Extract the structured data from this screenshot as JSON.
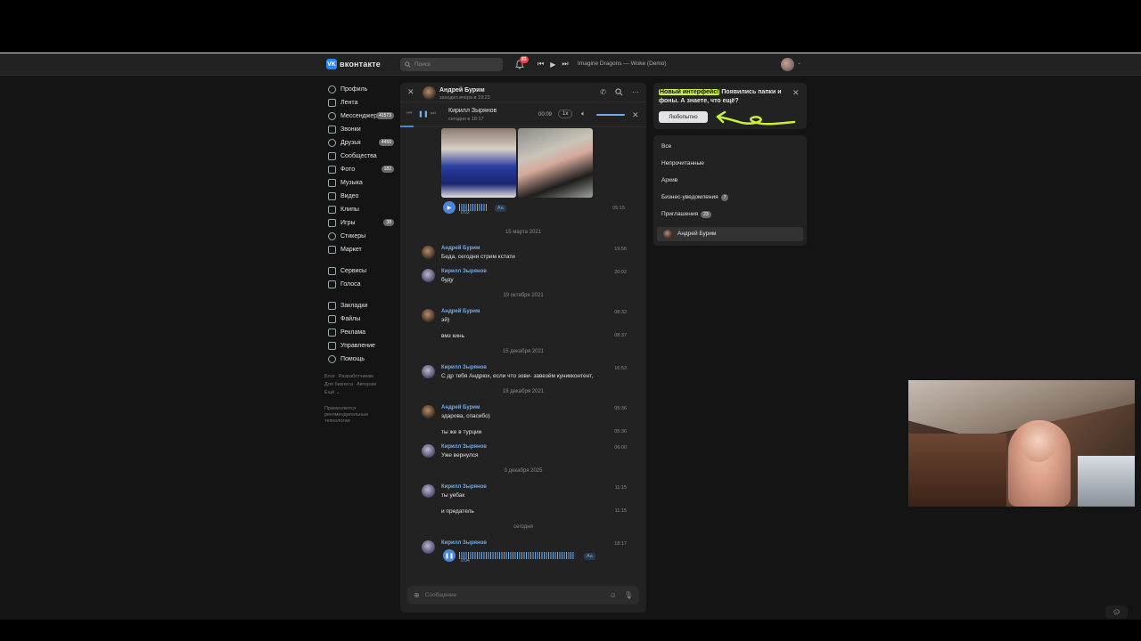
{
  "header": {
    "logo_text": "вконтакте",
    "search_placeholder": "Поиск",
    "notifications_count": "83",
    "track": "Imagine Dragons — Woke (Demo)"
  },
  "sidebar": {
    "items": [
      {
        "label": "Профиль"
      },
      {
        "label": "Лента"
      },
      {
        "label": "Мессенджер",
        "count": "41573"
      },
      {
        "label": "Звонки"
      },
      {
        "label": "Друзья",
        "count": "4456"
      },
      {
        "label": "Сообщества"
      },
      {
        "label": "Фото",
        "count": "182"
      },
      {
        "label": "Музыка"
      },
      {
        "label": "Видео"
      },
      {
        "label": "Клипы"
      },
      {
        "label": "Игры",
        "count": "38"
      },
      {
        "label": "Стикеры"
      },
      {
        "label": "Маркет"
      }
    ],
    "items2": [
      {
        "label": "Сервисы"
      },
      {
        "label": "Голоса"
      }
    ],
    "items3": [
      {
        "label": "Закладки"
      },
      {
        "label": "Файлы"
      },
      {
        "label": "Реклама"
      },
      {
        "label": "Управление"
      },
      {
        "label": "Помощь"
      }
    ],
    "footer": {
      "blog": "Блог",
      "developers": "Разработчикам",
      "business": "Для бизнеса",
      "authors": "Авторам",
      "more": "Ещё ⌄",
      "note": "Применяются рекомендательные технологии"
    }
  },
  "chat": {
    "name": "Андрей Бурим",
    "status": "заходил вчера в 19:23",
    "audio": {
      "title": "Кирилл Зырянов",
      "subtitle": "сегодня в 18:17",
      "elapsed": "00:09",
      "speed": "1x",
      "progress": 0.055
    },
    "first_voice": {
      "duration": "0:02",
      "time": "05:15",
      "aa": "Aa"
    },
    "dates": [
      "15 марта 2021",
      "19 октября 2021",
      "15 декабря 2021",
      "18 декабря 2021",
      "3 декабря 2025",
      "сегодня"
    ],
    "messages": [
      {
        "author": "Андрей Бурим",
        "text": "Беда, сегодня стрим кстати",
        "time": "19:56"
      },
      {
        "author": "Кирилл Зырянов",
        "text": "буду",
        "time": "20:02"
      },
      {
        "author": "Андрей Бурим",
        "text": "эй)",
        "time": "08:32"
      },
      {
        "text": "вмз кинь",
        "time": "08:37"
      },
      {
        "author": "Кирилл Зырянов",
        "text": "С др тебя Андрюх, если что зови- завезём куникконтент,",
        "time": "16:53"
      },
      {
        "author": "Андрей Бурим",
        "text": "здарова, спасибо)",
        "time": "05:36"
      },
      {
        "text": "ты же в турции",
        "time": "05:36"
      },
      {
        "author": "Кирилл Зырянов",
        "text": "Уже вернулся",
        "time": "06:00"
      },
      {
        "author": "Кирилл Зырянов",
        "text": "ты уебак",
        "time": "11:15"
      },
      {
        "text": "и предатель",
        "time": "11:15"
      },
      {
        "author": "Кирилл Зырянов",
        "text": "",
        "time": "18:17"
      }
    ],
    "last_voice": {
      "duration": "0:04",
      "aa": "Aa"
    },
    "composer_placeholder": "Сообщение"
  },
  "promo": {
    "highlight": "Новый интерфейс!",
    "text": " Появились папки и фоны. А знаете, что ещё?",
    "button": "Любопытно"
  },
  "folders": {
    "items": [
      {
        "label": "Все"
      },
      {
        "label": "Непрочитанные"
      },
      {
        "label": "Архив"
      },
      {
        "label": "Бизнес-уведомления",
        "count": "7"
      },
      {
        "label": "Приглашения",
        "count": "23"
      }
    ],
    "contact": "Андрей Бурим"
  },
  "colors": {
    "accent": "#71aaeb",
    "highlight": "#c8f03c",
    "badge": "#e64646"
  }
}
